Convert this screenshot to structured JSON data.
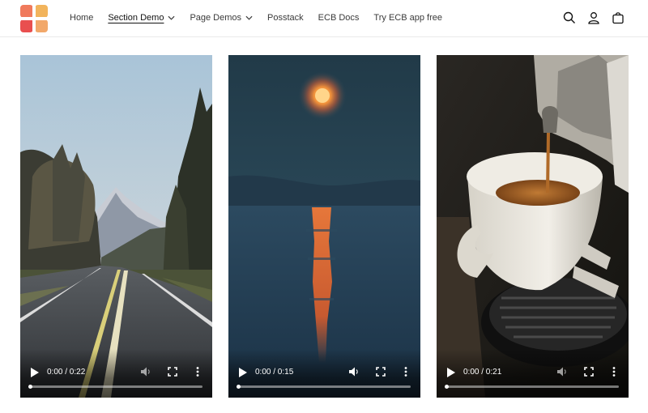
{
  "header": {
    "nav": [
      {
        "label": "Home",
        "dropdown": false,
        "active": false
      },
      {
        "label": "Section Demo",
        "dropdown": true,
        "active": true
      },
      {
        "label": "Page Demos",
        "dropdown": true,
        "active": false
      },
      {
        "label": "Posstack",
        "dropdown": false,
        "active": false
      },
      {
        "label": "ECB Docs",
        "dropdown": false,
        "active": false
      },
      {
        "label": "Try ECB app free",
        "dropdown": false,
        "active": false
      }
    ],
    "icons": [
      "search-icon",
      "account-icon",
      "cart-icon"
    ],
    "logo_colors": [
      "#e8584a",
      "#f2b45c",
      "#f07a5c",
      "#e94f4f"
    ]
  },
  "videos": [
    {
      "scene": "mountain-road",
      "time": "0:00 / 0:22",
      "progress": 0
    },
    {
      "scene": "moon-over-lake",
      "time": "0:00 / 0:15",
      "progress": 0
    },
    {
      "scene": "espresso-cup",
      "time": "0:00 / 0:21",
      "progress": 0
    }
  ]
}
